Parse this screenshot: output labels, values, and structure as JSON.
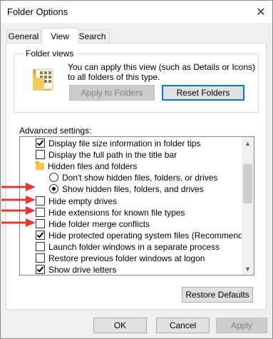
{
  "window": {
    "title": "Folder Options",
    "close_glyph": "✕"
  },
  "tabs": [
    {
      "label": "General"
    },
    {
      "label": "View"
    },
    {
      "label": "Search"
    }
  ],
  "folder_views": {
    "group_label": "Folder views",
    "description": "You can apply this view (such as Details or Icons) to all folders of this type.",
    "apply_label": "Apply to Folders",
    "reset_label": "Reset Folders"
  },
  "advanced": {
    "label": "Advanced settings:",
    "items": [
      {
        "type": "checkbox",
        "checked": true,
        "label": "Display file size information in folder tips"
      },
      {
        "type": "checkbox",
        "checked": false,
        "label": "Display the full path in the title bar"
      },
      {
        "type": "folder",
        "label": "Hidden files and folders"
      },
      {
        "type": "radio",
        "selected": false,
        "label": "Don't show hidden files, folders, or drives"
      },
      {
        "type": "radio",
        "selected": true,
        "label": "Show hidden files, folders, and drives"
      },
      {
        "type": "checkbox",
        "checked": false,
        "label": "Hide empty drives"
      },
      {
        "type": "checkbox",
        "checked": false,
        "label": "Hide extensions for known file types"
      },
      {
        "type": "checkbox",
        "checked": false,
        "label": "Hide folder merge conflicts"
      },
      {
        "type": "checkbox",
        "checked": true,
        "label": "Hide protected operating system files (Recommended)"
      },
      {
        "type": "checkbox",
        "checked": false,
        "label": "Launch folder windows in a separate process"
      },
      {
        "type": "checkbox",
        "checked": false,
        "label": "Restore previous folder windows at logon"
      },
      {
        "type": "checkbox",
        "checked": true,
        "label": "Show drive letters"
      }
    ]
  },
  "buttons": {
    "restore_defaults": "Restore Defaults",
    "ok": "OK",
    "cancel": "Cancel",
    "apply": "Apply"
  },
  "colors": {
    "annotation_arrow": "#e53935",
    "accent": "#0078d7"
  }
}
